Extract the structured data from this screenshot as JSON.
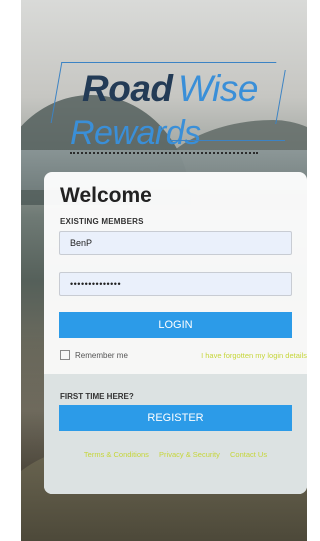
{
  "brand": {
    "road": "Road",
    "wise": "Wise",
    "rewards": "Rewards"
  },
  "login": {
    "welcome": "Welcome",
    "existing_members": "EXISTING MEMBERS",
    "username_value": "BenP",
    "password_value": "••••••••••••••",
    "login_label": "LOGIN",
    "remember_label": "Remember me",
    "remember_checked": false,
    "forgot_label": "I have forgotten my login details"
  },
  "register": {
    "first_time": "FIRST TIME HERE?",
    "register_label": "REGISTER"
  },
  "footer": {
    "terms": "Terms & Conditions",
    "privacy": "Privacy & Security",
    "contact": "Contact Us"
  },
  "colors": {
    "accent_blue": "#2c9be8",
    "link_green": "#c6d63a",
    "brand_dark": "#233b56"
  }
}
